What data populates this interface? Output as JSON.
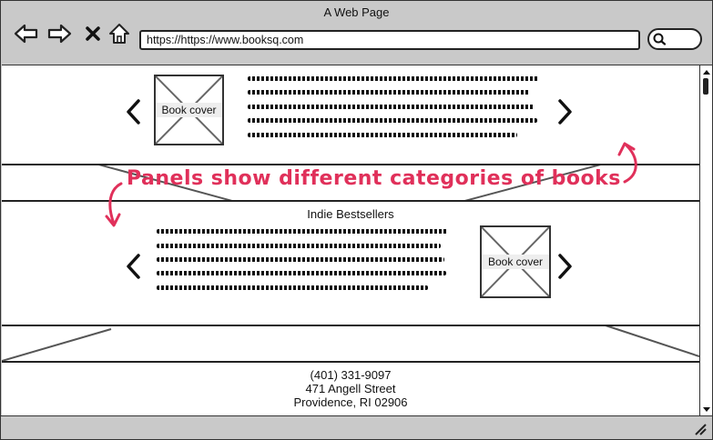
{
  "window": {
    "title": "A Web Page"
  },
  "toolbar": {
    "back_icon": "arrow-left-icon",
    "forward_icon": "arrow-right-icon",
    "close_icon": "close-icon",
    "home_icon": "home-icon",
    "url": "https://https://www.booksq.com",
    "search_icon": "search-icon"
  },
  "panels": [
    {
      "title": "",
      "cover_label": "Book cover",
      "prev_icon": "chevron-left-icon",
      "next_icon": "chevron-right-icon"
    },
    {
      "title": "Indie Bestsellers",
      "cover_label": "Book cover",
      "prev_icon": "chevron-left-icon",
      "next_icon": "chevron-right-icon"
    }
  ],
  "annotation": {
    "text": "Panels show different categories of books",
    "color": "#e0305a"
  },
  "footer": {
    "phone": "(401) 331-9097",
    "street": "471 Angell Street",
    "city": "Providence, RI 02906"
  }
}
